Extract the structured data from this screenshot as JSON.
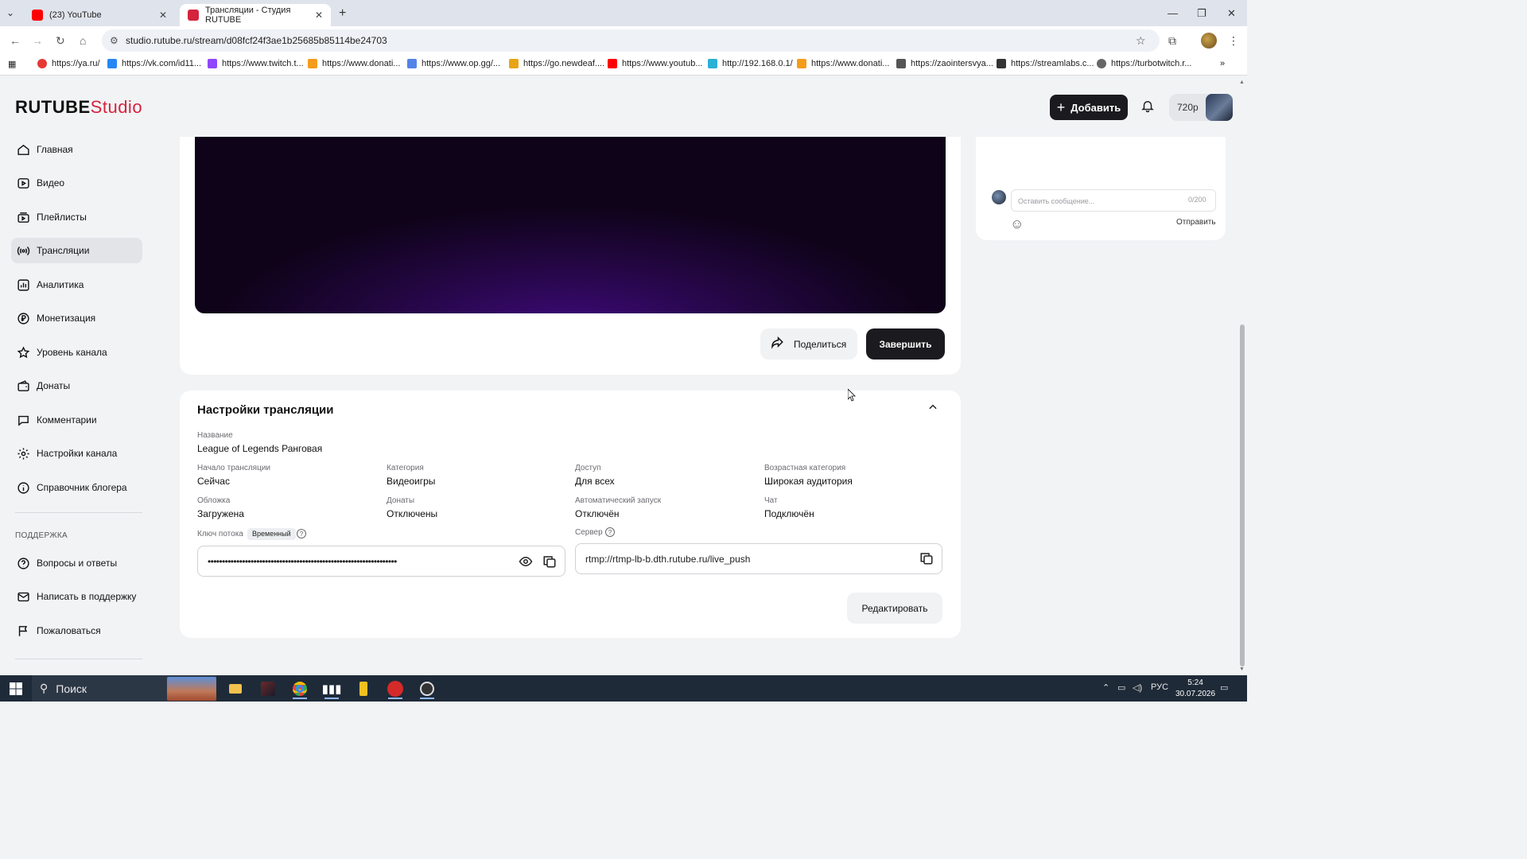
{
  "browser": {
    "tabs": [
      {
        "title": "(23) YouTube",
        "active": false,
        "color": "#ff0000"
      },
      {
        "title": "Трансляции - Студия RUTUBE",
        "active": true,
        "color": "#d4233d"
      }
    ],
    "url": "studio.rutube.ru/stream/d08fcf24f3ae1b25685b85114be24703",
    "bookmarks": [
      {
        "label": "https://ya.ru/",
        "color": "#e53935"
      },
      {
        "label": "https://vk.com/id11...",
        "color": "#2787f5"
      },
      {
        "label": "https://www.twitch.t...",
        "color": "#9146ff"
      },
      {
        "label": "https://www.donati...",
        "color": "#f59c1a"
      },
      {
        "label": "https://www.op.gg/...",
        "color": "#5383e8"
      },
      {
        "label": "https://go.newdeaf....",
        "color": "#e8a317"
      },
      {
        "label": "https://www.youtub...",
        "color": "#ff0000"
      },
      {
        "label": "http://192.168.0.1/",
        "color": "#2bb0d6"
      },
      {
        "label": "https://www.donati...",
        "color": "#f59c1a"
      },
      {
        "label": "https://zaointersvya...",
        "color": "#555555"
      },
      {
        "label": "https://streamlabs.c...",
        "color": "#333333"
      },
      {
        "label": "https://turbotwitch.r...",
        "color": "#666666"
      }
    ]
  },
  "header": {
    "logo_text": "RUTUBE",
    "logo_studio": "Studio",
    "add_label": "Добавить",
    "quality": "720p"
  },
  "sidebar": {
    "items": [
      {
        "label": "Главная",
        "icon": "home-icon"
      },
      {
        "label": "Видео",
        "icon": "video-icon"
      },
      {
        "label": "Плейлисты",
        "icon": "playlist-icon"
      },
      {
        "label": "Трансляции",
        "icon": "broadcast-icon",
        "active": true
      },
      {
        "label": "Аналитика",
        "icon": "analytics-icon"
      },
      {
        "label": "Монетизация",
        "icon": "ruble-icon"
      },
      {
        "label": "Уровень канала",
        "icon": "star-icon"
      },
      {
        "label": "Донаты",
        "icon": "wallet-icon"
      },
      {
        "label": "Комментарии",
        "icon": "comment-icon"
      },
      {
        "label": "Настройки канала",
        "icon": "gear-icon"
      },
      {
        "label": "Справочник блогера",
        "icon": "info-icon"
      }
    ],
    "support_title": "ПОДДЕРЖКА",
    "support_items": [
      {
        "label": "Вопросы и ответы",
        "icon": "question-icon"
      },
      {
        "label": "Написать в поддержку",
        "icon": "mail-icon"
      },
      {
        "label": "Пожаловаться",
        "icon": "flag-icon"
      }
    ]
  },
  "stream": {
    "share_label": "Поделиться",
    "finish_label": "Завершить"
  },
  "chat": {
    "placeholder": "Оставить сообщение...",
    "counter": "0/200",
    "send_label": "Отправить"
  },
  "settings": {
    "title": "Настройки трансляции",
    "name_label": "Название",
    "name_value": "League of Legends Ранговая",
    "fields": [
      {
        "label": "Начало трансляции",
        "value": "Сейчас"
      },
      {
        "label": "Категория",
        "value": "Видеоигры"
      },
      {
        "label": "Доступ",
        "value": "Для всех"
      },
      {
        "label": "Возрастная категория",
        "value": "Широкая аудитория"
      },
      {
        "label": "Обложка",
        "value": "Загружена"
      },
      {
        "label": "Донаты",
        "value": "Отключены"
      },
      {
        "label": "Автоматический запуск",
        "value": "Отключён"
      },
      {
        "label": "Чат",
        "value": "Подключён"
      }
    ],
    "key_label": "Ключ потока",
    "key_badge": "Временный",
    "key_value": "••••••••••••••••••••••••••••••••••••••••••••••••••••••••••••••••••",
    "server_label": "Сервер",
    "server_value": "rtmp://rtmp-lb-b.dth.rutube.ru/live_push",
    "edit_label": "Редактировать"
  },
  "taskbar": {
    "search_label": "Поиск",
    "lang": "РУС",
    "time": "5:24",
    "date": "30.07.2026"
  }
}
